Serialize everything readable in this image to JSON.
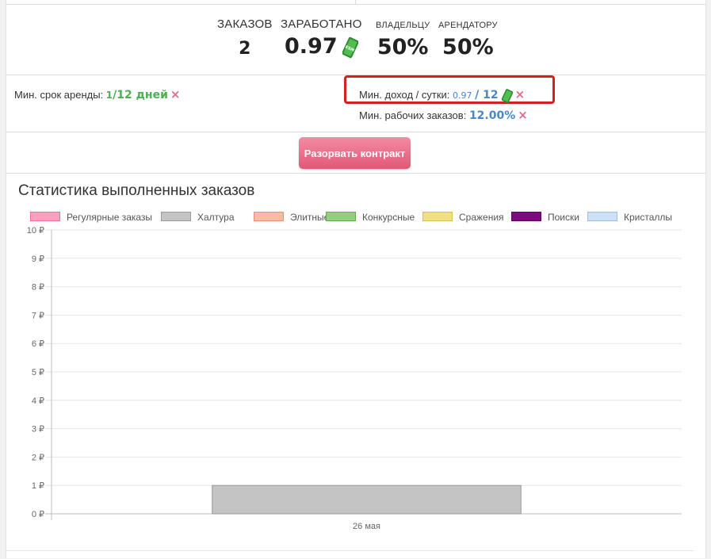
{
  "stats": {
    "orders": {
      "label": "ЗАКАЗОВ",
      "value": "2"
    },
    "earned": {
      "label": "ЗАРАБОТАНО",
      "value": "0.97",
      "icon": "money-icon"
    },
    "owner": {
      "label": "ВЛАДЕЛЬЦУ",
      "value": "50%"
    },
    "tenant": {
      "label": "АРЕНДАТОРУ",
      "value": "50%"
    }
  },
  "terms": {
    "min_rent": {
      "label": "Мин. срок аренды:",
      "value_a": "1",
      "value_b": "/12 дней",
      "remove": "×"
    },
    "min_income": {
      "label": "Мин. доход / сутки:",
      "current": "0.97",
      "target": "/ 12",
      "remove": "×"
    },
    "min_orders": {
      "label": "Мин. рабочих заказов:",
      "value": "12.00%",
      "remove": "×"
    }
  },
  "break_button": "Разорвать контракт",
  "chart_data": {
    "type": "bar",
    "title": "Статистика выполненных заказов",
    "categories": [
      "26 мая"
    ],
    "legend": [
      "Регулярные заказы",
      "Халтура",
      "Элитные",
      "Конкурсные",
      "Сражения",
      "Поиски",
      "Кристаллы"
    ],
    "legend_colors": [
      "#f7a3bf",
      "#c4c4c4",
      "#fcb9a3",
      "#93d07c",
      "#f1df83",
      "#7d0a80",
      "#cce0f6"
    ],
    "legend_borders": [
      "#ee6f97",
      "#9a9a9a",
      "#f28d6f",
      "#5eb04a",
      "#d8c34f",
      "#5e005f",
      "#9fbfe4"
    ],
    "series": [
      {
        "name": "Регулярные заказы",
        "values": [
          0
        ]
      },
      {
        "name": "Халтура",
        "values": [
          1
        ]
      },
      {
        "name": "Элитные",
        "values": [
          0
        ]
      },
      {
        "name": "Конкурсные",
        "values": [
          0
        ]
      },
      {
        "name": "Сражения",
        "values": [
          0
        ]
      },
      {
        "name": "Поиски",
        "values": [
          0
        ]
      },
      {
        "name": "Кристаллы",
        "values": [
          0
        ]
      }
    ],
    "y_ticks": [
      "0 ₽",
      "1 ₽",
      "2 ₽",
      "3 ₽",
      "4 ₽",
      "5 ₽",
      "6 ₽",
      "7 ₽",
      "8 ₽",
      "9 ₽",
      "10 ₽"
    ],
    "ylim": [
      0,
      10
    ],
    "grid": true,
    "legend_position": "top"
  }
}
